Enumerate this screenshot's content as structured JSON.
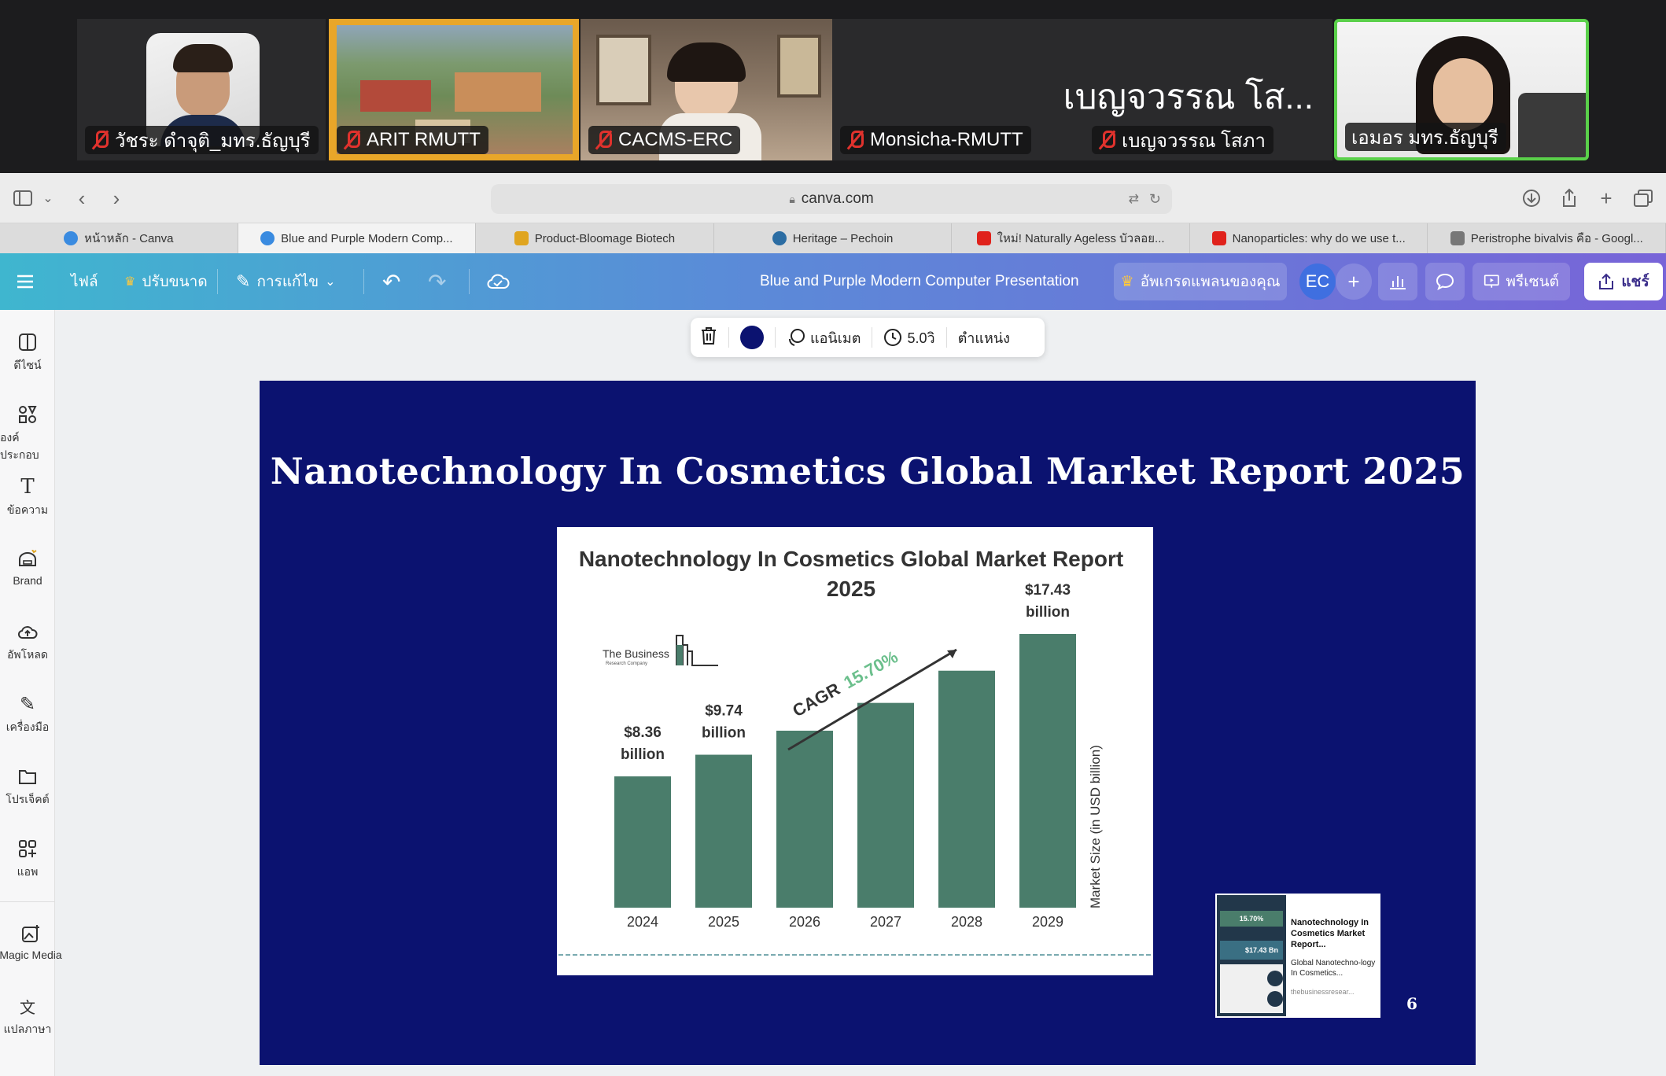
{
  "meeting": {
    "participants": [
      {
        "name": "วัชระ ดำจุติ_มทร.ธัญบุรี",
        "muted": true
      },
      {
        "name": "ARIT RMUTT",
        "muted": true
      },
      {
        "name": "CACMS-ERC",
        "muted": true
      },
      {
        "name": "Monsicha-RMUTT",
        "muted": true
      },
      {
        "name": "เบญจวรรณ โสภา",
        "muted": true
      },
      {
        "name": "เอมอร มทร.ธัญบุรี",
        "muted": false,
        "active_speaker": true
      }
    ],
    "big_name": "เบญจวรรณ โส...",
    "mic_off_color": "#e0322d",
    "active_border_color": "#5ad04a"
  },
  "browser": {
    "url": "canva.com",
    "tabs": [
      {
        "label": "หน้าหลัก - Canva",
        "icon": "canva-icon",
        "color": "#3a8be0"
      },
      {
        "label": "Blue and Purple Modern Comp...",
        "icon": "canva-icon",
        "color": "#3a8be0",
        "active": true
      },
      {
        "label": "Product-Bloomage Biotech",
        "icon": "bloomage-icon",
        "color": "#e0a520"
      },
      {
        "label": "Heritage – Pechoin",
        "icon": "wordpress-icon",
        "color": "#2c6da3"
      },
      {
        "label": "ใหม่! Naturally Ageless บัวลอย...",
        "icon": "youtube-icon",
        "color": "#e0221c"
      },
      {
        "label": "Nanoparticles: why do we use t...",
        "icon": "youtube-icon",
        "color": "#e0221c"
      },
      {
        "label": "Peristrophe bivalvis คือ - Googl...",
        "icon": "google-icon",
        "color": "#777777"
      }
    ]
  },
  "canva": {
    "menu": {
      "file": "ไฟล์",
      "resize": "ปรับขนาด",
      "edit": "การแก้ไข",
      "doc_title": "Blue and Purple Modern Computer Presentation",
      "upgrade": "อัพเกรดแพลนของคุณ",
      "avatar": "EC",
      "present": "พรีเซนต์",
      "share": "แชร์"
    },
    "sidebar": [
      {
        "label": "ดีไซน์",
        "icon": "design-icon"
      },
      {
        "label": "องค์ประกอบ",
        "icon": "elements-icon"
      },
      {
        "label": "ข้อความ",
        "icon": "text-icon"
      },
      {
        "label": "Brand",
        "icon": "brand-icon"
      },
      {
        "label": "อัพโหลด",
        "icon": "upload-icon"
      },
      {
        "label": "เครื่องมือ",
        "icon": "draw-icon"
      },
      {
        "label": "โปรเจ็คต์",
        "icon": "folder-icon"
      },
      {
        "label": "แอพ",
        "icon": "apps-icon"
      },
      {
        "label": "Magic Media",
        "icon": "magic-media-icon"
      },
      {
        "label": "แปลภาษา",
        "icon": "translate-icon"
      }
    ],
    "floating": {
      "color": "#0b1270",
      "animate": "แอนิเมต",
      "duration": "5.0วิ",
      "position": "ตำแหน่ง"
    }
  },
  "slide": {
    "title": "Nanotechnology In Cosmetics Global Market Report 2025",
    "page_number": "6",
    "background": "#0b1270",
    "thumbnail": {
      "heading": "Nanotechnology In Cosmetics Market Report...",
      "sub": "Global Nanotechno-logy In Cosmetics...",
      "source": "thebusinessresear...",
      "badge_1": "15.70%",
      "badge_2": "$17.43 Bn"
    }
  },
  "chart_data": {
    "type": "bar",
    "title": "Nanotechnology In Cosmetics Global Market Report 2025",
    "logo_text": "The Business",
    "logo_sub": "Research Company",
    "categories": [
      "2024",
      "2025",
      "2026",
      "2027",
      "2028",
      "2029"
    ],
    "values": [
      8.36,
      9.74,
      11.27,
      13.04,
      15.09,
      17.43
    ],
    "data_labels": [
      {
        "index": 0,
        "line1": "$8.36",
        "line2": "billion"
      },
      {
        "index": 1,
        "line1": "$9.74",
        "line2": "billion"
      },
      {
        "index": 5,
        "line1": "$17.43",
        "line2": "billion"
      }
    ],
    "ylabel": "Market Size (in USD billion)",
    "cagr_label": "CAGR",
    "cagr_value": "15.70%",
    "ylim": [
      0,
      17.43
    ],
    "bar_color": "#4a7d6b",
    "cagr_color": "#6bbf8c"
  }
}
